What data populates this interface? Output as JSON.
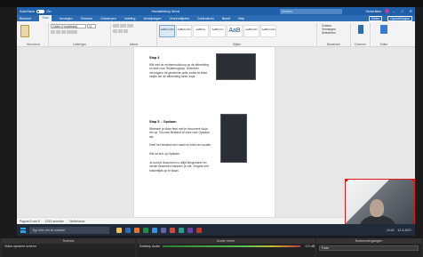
{
  "titlebar": {
    "autosave_label": "AutoSave",
    "autosave_state": "On",
    "doc_title": "Handleiding Word",
    "search_placeholder": "Zoeken",
    "user": "Gebruiker"
  },
  "menubar": {
    "tabs": [
      "Bestand",
      "Start",
      "Invoegen",
      "Tekenen",
      "Ontwerpen",
      "Indeling",
      "Verwijzingen",
      "Verzendlijsten",
      "Controleren",
      "Beeld",
      "Help"
    ],
    "active_tab": "Start",
    "right_items": [
      "Delen",
      "Opmerkingen"
    ]
  },
  "ribbon": {
    "groups": [
      "Klembord",
      "Lettertype",
      "Alinea",
      "Stijlen",
      "Bewerken",
      "Dicteren",
      "Editor"
    ],
    "font_name": "Calibri (Hoofdtekst)",
    "font_size": "11",
    "style_tiles": [
      "AaBbCcDd",
      "AaBbCcDd",
      "AaBbCc",
      "AaBbCcC",
      "AaB",
      "AaBbCcD",
      "AaBbCcDd"
    ],
    "style_names": [
      "Standaard",
      "Geen afst.",
      "Kop 1",
      "Kop 2",
      "Titel",
      "Ondertitel",
      "Nadruk"
    ],
    "edit_items": [
      "Zoeken",
      "Vervangen",
      "Selecteren"
    ]
  },
  "document": {
    "heading_1": "Stap 4",
    "para_1": "Klik met de rechtermuisknop op de afbeelding en kies voor Tekstterugloop. Selecteer vervolgens de gewenste optie zodat de tekst netjes om de afbeelding heen loopt.",
    "heading_2": "Stap 5 – Opslaan",
    "para_2a": "Wanneer je klaar bent met je document sla je het op. Ga naar Bestand en kies voor Opslaan als.",
    "para_2b": "Geef het bestand een naam en kies een locatie.",
    "para_2c": "Klik tot slot op Opslaan.",
    "para_2d": "Je kunt je document nu altijd terugvinden en verder bewerken wanneer je wilt. Vergeet niet tussentijds op te slaan."
  },
  "statusbar": {
    "page": "Pagina 5 van 6",
    "words": "1253 woorden",
    "language": "Nederlands",
    "focus": "Focus",
    "zoom": "100%"
  },
  "taskbar": {
    "search_placeholder": "Typ hier om te zoeken",
    "time": "10:42",
    "date": "12-3-2021"
  },
  "obs": {
    "scenes_title": "Scènes",
    "scene_item": "Video opname scherm",
    "mixer_title": "Audio mixer",
    "mixer_source": "Desktop Audio",
    "mixer_level": "0.0 dB",
    "transition_title": "Scèneovergangen",
    "transition_value": "Fade"
  },
  "colors": {
    "word_blue": "#1f5fa8",
    "webcam_border": "#e01818",
    "taskbar": "#202c3a"
  }
}
